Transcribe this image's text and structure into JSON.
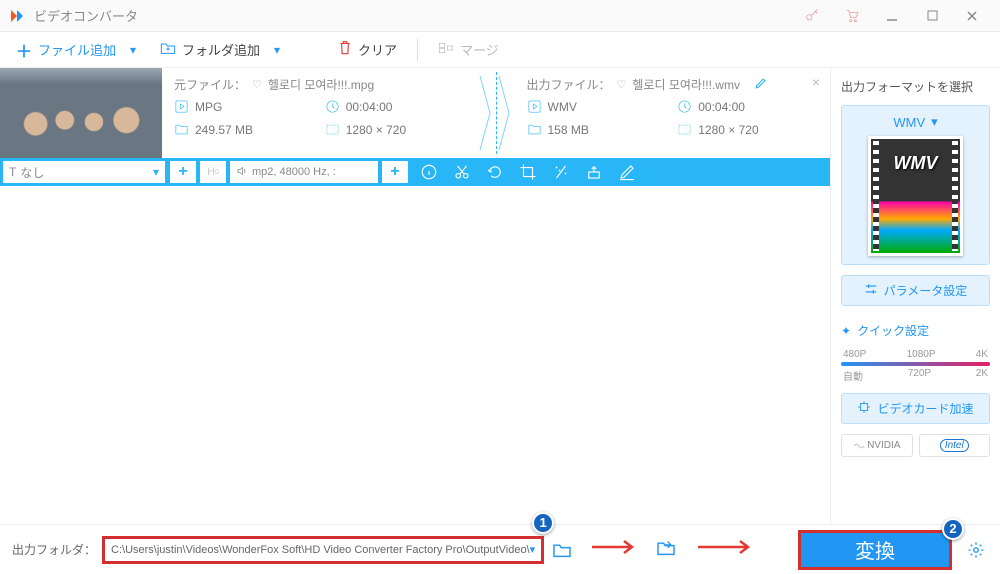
{
  "window": {
    "title": "ビデオコンバータ"
  },
  "toolbar": {
    "add_file": "ファイル追加",
    "add_folder": "フォルダ追加",
    "clear": "クリア",
    "merge": "マージ"
  },
  "file": {
    "src_label": "元ファイル：",
    "src_name": "헬로디 모여라!!!.mpg",
    "src_format": "MPG",
    "src_duration": "00:04:00",
    "src_size": "249.57 MB",
    "src_res": "1280 × 720",
    "out_label": "出力ファイル：",
    "out_name": "헬로디 모여라!!!.wmv",
    "out_format": "WMV",
    "out_duration": "00:04:00",
    "out_size": "158 MB",
    "out_res": "1280 × 720"
  },
  "bluebar": {
    "subtitle": "なし",
    "audio": "mp2, 48000 Hz, :"
  },
  "right": {
    "format_label": "出力フォーマットを選択",
    "format": "WMV",
    "format_icon_text": "WMV",
    "param": "パラメータ設定",
    "quick": "クイック設定",
    "res": {
      "r1": "480P",
      "r2": "1080P",
      "r3": "4K",
      "r4": "自動",
      "r5": "720P",
      "r6": "2K"
    },
    "gpu": "ビデオカード加速",
    "nvidia": "NVIDIA",
    "intel": "Intel"
  },
  "bottom": {
    "label": "出力フォルダ：",
    "path": "C:\\Users\\justin\\Videos\\WonderFox Soft\\HD Video Converter Factory Pro\\OutputVideo\\",
    "convert": "変換"
  },
  "annotations": {
    "b1": "1",
    "b2": "2"
  }
}
